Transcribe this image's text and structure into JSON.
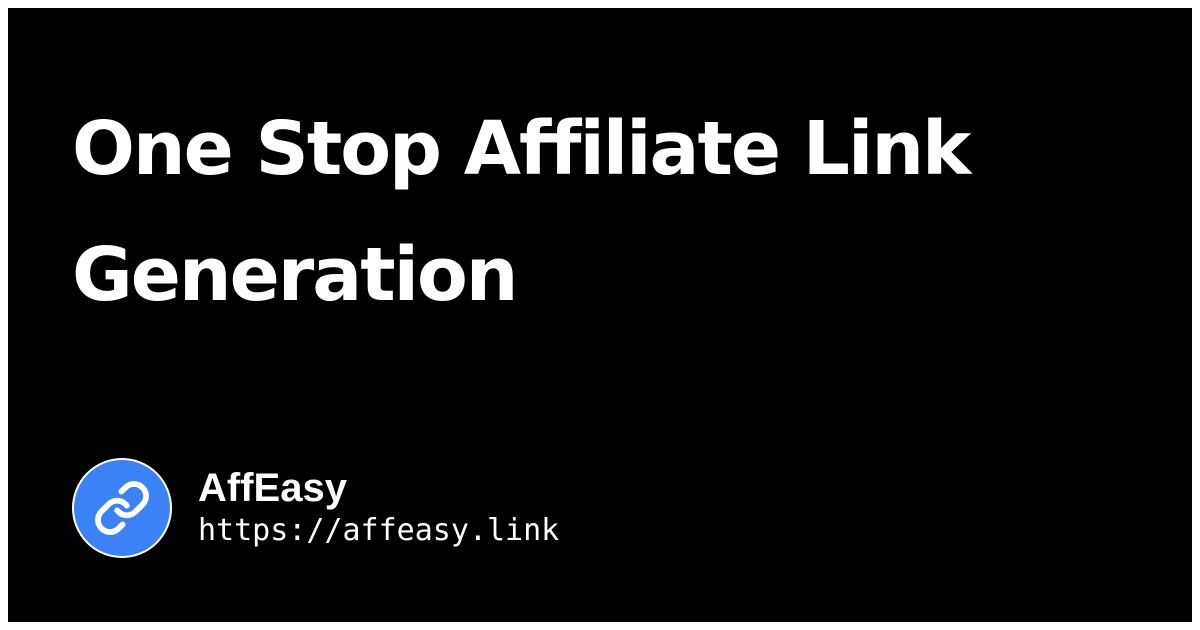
{
  "card": {
    "headline": "One Stop Affiliate Link Generation",
    "background_color": "#000000",
    "text_color": "#ffffff"
  },
  "brand": {
    "logo_icon": "link-icon",
    "logo_color": "#3b82f6",
    "name": "AffEasy",
    "url": "https://affeasy.link"
  }
}
